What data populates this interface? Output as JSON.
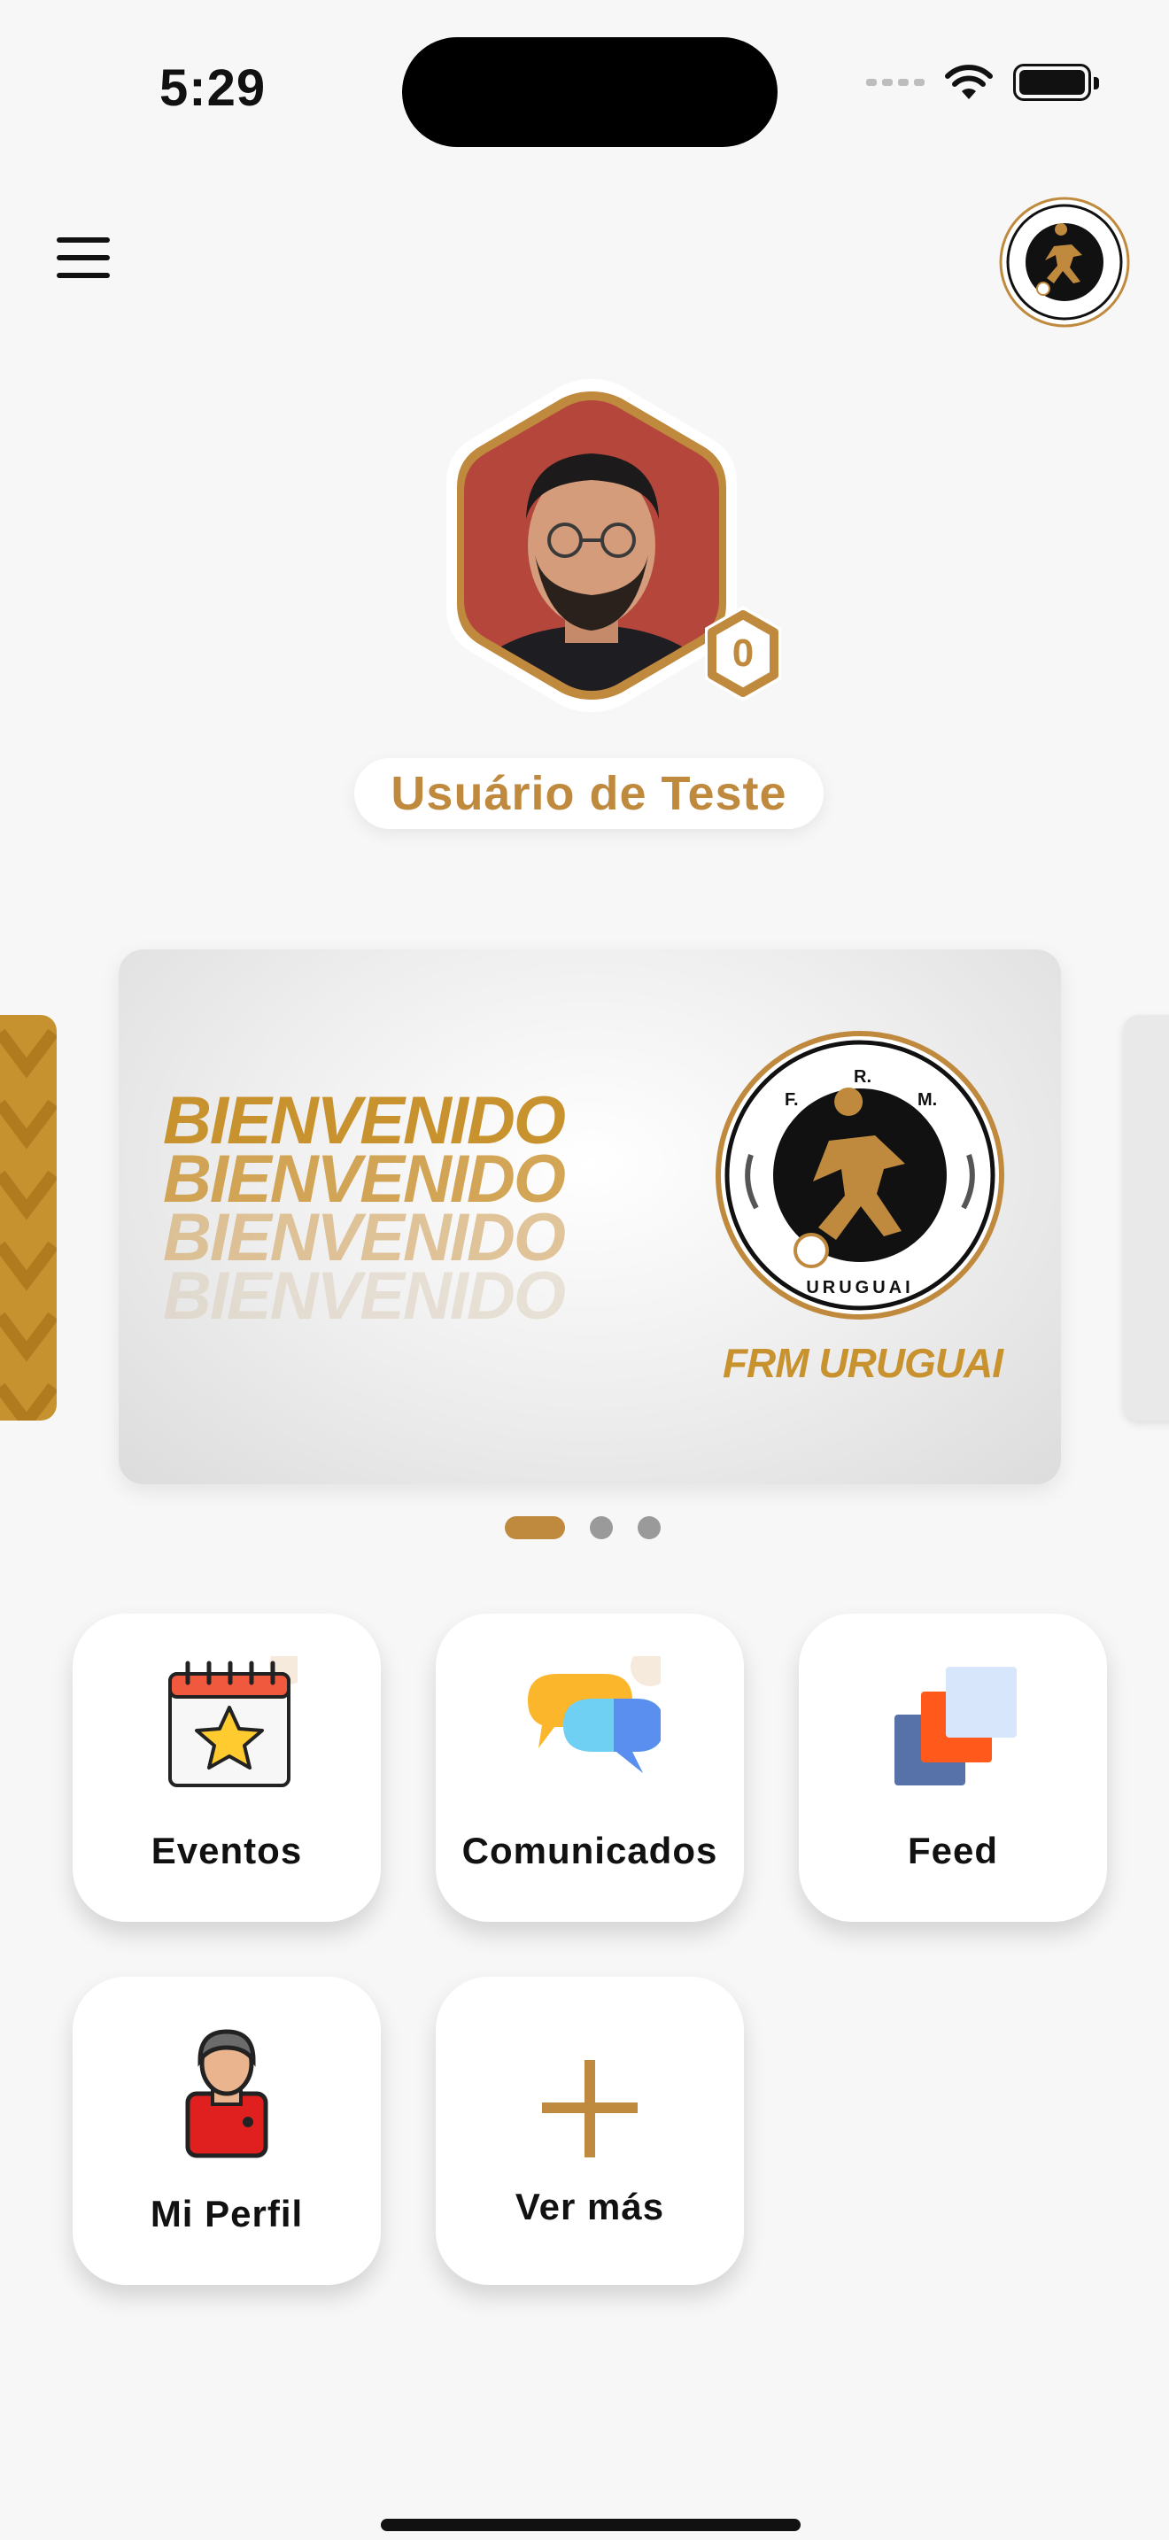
{
  "status_bar": {
    "time": "5:29"
  },
  "profile": {
    "name": "Usuário de Teste",
    "level": "0"
  },
  "banner": {
    "headline": "BIENVENIDO",
    "caption": "FRM URUGUAI",
    "logo_text": {
      "f": "F.",
      "r": "R.",
      "m": "M.",
      "country": "URUGUAI"
    }
  },
  "carousel": {
    "pages": 3,
    "active_index": 0
  },
  "tiles": [
    {
      "label": "Eventos",
      "icon": "calendar-star-icon"
    },
    {
      "label": "Comunicados",
      "icon": "chat-bubbles-icon"
    },
    {
      "label": "Feed",
      "icon": "stacked-cards-icon"
    },
    {
      "label": "Mi Perfil",
      "icon": "user-profile-icon"
    },
    {
      "label": "Ver más",
      "icon": "plus-icon"
    }
  ],
  "colors": {
    "accent": "#c08a3e",
    "background": "#f7f7f7",
    "tile": "#ffffff"
  }
}
